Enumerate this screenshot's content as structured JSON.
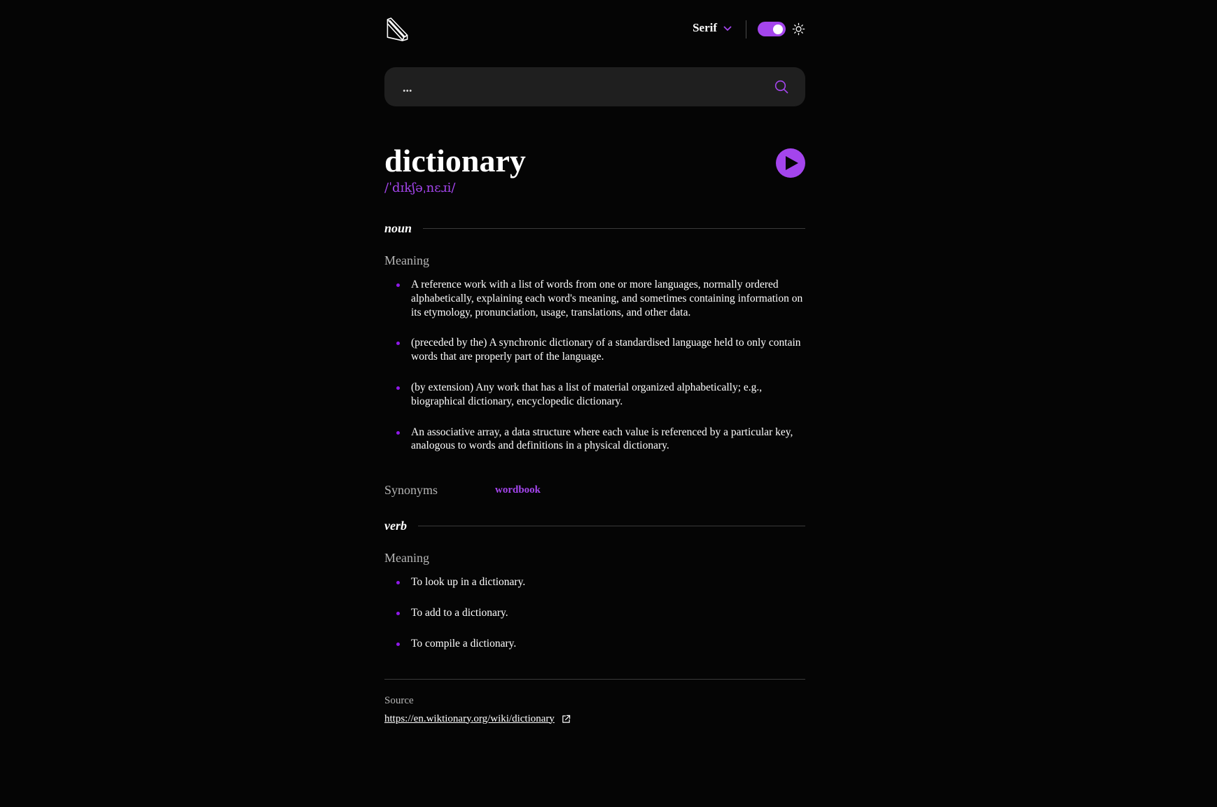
{
  "header": {
    "logo_icon": "book-icon",
    "font_selector": {
      "label": "Serif",
      "icon": "chevron-down-icon"
    },
    "theme_toggle": {
      "state": "on",
      "icon": "sun-icon"
    }
  },
  "search": {
    "placeholder": "...",
    "value": "",
    "icon": "search-icon"
  },
  "entry": {
    "word": "dictionary",
    "phonetic": "/ˈdɪkʃəˌnɛɹi/",
    "play_icon": "play-icon"
  },
  "noun": {
    "label": "noun",
    "meaning_title": "Meaning",
    "definitions": [
      "A reference work with a list of words from one or more languages, normally ordered alphabetically, explaining each word's meaning, and sometimes containing information on its etymology, pronunciation, usage, translations, and other data.",
      "(preceded by the) A synchronic dictionary of a standardised language held to only contain words that are properly part of the language.",
      "(by extension) Any work that has a list of material organized alphabetically; e.g., biographical dictionary, encyclopedic dictionary.",
      "An associative array, a data structure where each value is referenced by a particular key, analogous to words and definitions in a physical dictionary."
    ],
    "synonyms_label": "Synonyms",
    "synonyms": [
      "wordbook"
    ]
  },
  "verb": {
    "label": "verb",
    "meaning_title": "Meaning",
    "definitions": [
      "To look up in a dictionary.",
      "To add to a dictionary.",
      "To compile a dictionary."
    ]
  },
  "source": {
    "label": "Source",
    "url": "https://en.wiktionary.org/wiki/dictionary",
    "icon": "external-link-icon"
  },
  "colors": {
    "accent": "#a445ed",
    "background": "#050505",
    "search_bg": "#1f1f1f",
    "muted_text": "#b5b5b5"
  }
}
